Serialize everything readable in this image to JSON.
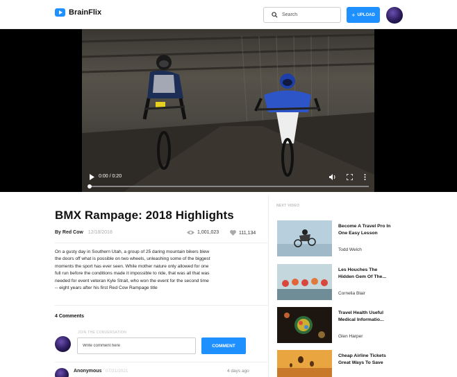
{
  "app": {
    "name": "BrainFlix"
  },
  "header": {
    "search_placeholder": "Search",
    "upload_label": "UPLOAD",
    "upload_plus": "+"
  },
  "player": {
    "time": "0:00 / 0:20",
    "progress": 0
  },
  "video": {
    "title": "BMX Rampage: 2018 Highlights",
    "author": "By Red Cow",
    "date": "12/18/2018",
    "views": "1,001,023",
    "likes": "111,134",
    "description": "On a gusty day in Southern Utah, a group of 25 daring mountain bikers blew the doors off what is possible on two wheels, unleashing some of the biggest moments the sport has ever seen. While mother nature only allowed for one full run before the conditions made it impossible to ride, that was all that was needed for event veteran Kyle Strait, who won the event for the second time -- eight years after his first Red Cow Rampage title"
  },
  "comments": {
    "count_label": "4 Comments",
    "join_label": "JOIN THE CONVERSATION",
    "input_placeholder": "Write comment here",
    "button_label": "COMMENT",
    "items": [
      {
        "name": "Anonymous",
        "date": "07/31/2021",
        "ago": "4 days ago"
      }
    ]
  },
  "sidebar": {
    "label": "NEXT VIDEO",
    "items": [
      {
        "title": "Become A Travel Pro In One Easy Lesson",
        "author": "Todd Welch"
      },
      {
        "title": "Les Houches The Hidden Gem Of The...",
        "author": "Cornelia Blair"
      },
      {
        "title": "Travel Health Useful Medical Informatio...",
        "author": "Glen Harper"
      },
      {
        "title": "Cheap Airline Tickets Great Ways To Save",
        "author": ""
      }
    ]
  },
  "colors": {
    "accent": "#1e90ff",
    "text": "#111111",
    "muted": "#aaaaaa"
  },
  "icons": [
    "play-icon",
    "search-icon",
    "eye-icon",
    "heart-icon",
    "volume-icon",
    "fullscreen-icon",
    "more-icon"
  ]
}
